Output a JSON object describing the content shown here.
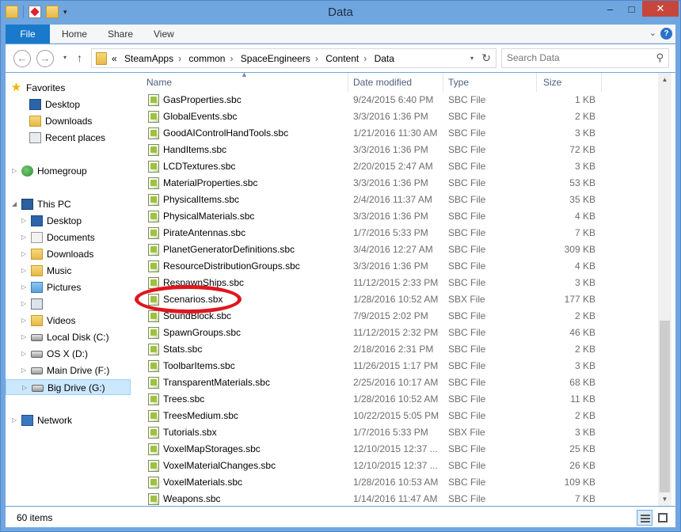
{
  "window": {
    "title": "Data",
    "minimize": "–",
    "maximize": "□",
    "close": "✕"
  },
  "ribbon": {
    "tabs": [
      "File",
      "Home",
      "Share",
      "View"
    ],
    "expand": "⌄",
    "help": "?"
  },
  "nav": {
    "back": "←",
    "forward": "→",
    "up": "↑",
    "history_drop": "▾",
    "breadcrumbs": [
      "«",
      "SteamApps",
      "common",
      "SpaceEngineers",
      "Content",
      "Data"
    ],
    "search_placeholder": "Search Data"
  },
  "navpane": {
    "items": [
      {
        "label": "Favorites",
        "icon": "star-icon"
      },
      {
        "label": "Desktop",
        "icon": "desktop-icon"
      },
      {
        "label": "Downloads",
        "icon": "downloads-icon"
      },
      {
        "label": "Recent places",
        "icon": "recent-places-icon"
      },
      {
        "label": "Homegroup",
        "icon": "homegroup-icon"
      },
      {
        "label": "This PC",
        "icon": "this-pc-icon"
      },
      {
        "label": "Desktop",
        "icon": "desktop-icon"
      },
      {
        "label": "Documents",
        "icon": "documents-icon"
      },
      {
        "label": "Downloads",
        "icon": "downloads-icon"
      },
      {
        "label": "Music",
        "icon": "music-icon"
      },
      {
        "label": "Pictures",
        "icon": "pictures-icon"
      },
      {
        "label": "",
        "icon": "camera-icon"
      },
      {
        "label": "Videos",
        "icon": "videos-icon"
      },
      {
        "label": "Local Disk (C:)",
        "icon": "drive-icon"
      },
      {
        "label": "OS X (D:)",
        "icon": "drive-icon"
      },
      {
        "label": "Main Drive (F:)",
        "icon": "drive-icon"
      },
      {
        "label": "Big Drive (G:)",
        "icon": "drive-icon"
      },
      {
        "label": "Network",
        "icon": "network-icon"
      }
    ]
  },
  "columns": {
    "name": "Name",
    "date": "Date modified",
    "type": "Type",
    "size": "Size",
    "sort_indicator": "▲"
  },
  "files": [
    {
      "name": "GasProperties.sbc",
      "date": "9/24/2015 6:40 PM",
      "type": "SBC File",
      "size": "1 KB"
    },
    {
      "name": "GlobalEvents.sbc",
      "date": "3/3/2016 1:36 PM",
      "type": "SBC File",
      "size": "2 KB"
    },
    {
      "name": "GoodAIControlHandTools.sbc",
      "date": "1/21/2016 11:30 AM",
      "type": "SBC File",
      "size": "3 KB"
    },
    {
      "name": "HandItems.sbc",
      "date": "3/3/2016 1:36 PM",
      "type": "SBC File",
      "size": "72 KB"
    },
    {
      "name": "LCDTextures.sbc",
      "date": "2/20/2015 2:47 AM",
      "type": "SBC File",
      "size": "3 KB"
    },
    {
      "name": "MaterialProperties.sbc",
      "date": "3/3/2016 1:36 PM",
      "type": "SBC File",
      "size": "53 KB"
    },
    {
      "name": "PhysicalItems.sbc",
      "date": "2/4/2016 11:37 AM",
      "type": "SBC File",
      "size": "35 KB"
    },
    {
      "name": "PhysicalMaterials.sbc",
      "date": "3/3/2016 1:36 PM",
      "type": "SBC File",
      "size": "4 KB"
    },
    {
      "name": "PirateAntennas.sbc",
      "date": "1/7/2016 5:33 PM",
      "type": "SBC File",
      "size": "7 KB"
    },
    {
      "name": "PlanetGeneratorDefinitions.sbc",
      "date": "3/4/2016 12:27 AM",
      "type": "SBC File",
      "size": "309 KB"
    },
    {
      "name": "ResourceDistributionGroups.sbc",
      "date": "3/3/2016 1:36 PM",
      "type": "SBC File",
      "size": "4 KB"
    },
    {
      "name": "RespawnShips.sbc",
      "date": "11/12/2015 2:33 PM",
      "type": "SBC File",
      "size": "3 KB"
    },
    {
      "name": "Scenarios.sbx",
      "date": "1/28/2016 10:52 AM",
      "type": "SBX File",
      "size": "177 KB"
    },
    {
      "name": "SoundBlock.sbc",
      "date": "7/9/2015 2:02 PM",
      "type": "SBC File",
      "size": "2 KB"
    },
    {
      "name": "SpawnGroups.sbc",
      "date": "11/12/2015 2:32 PM",
      "type": "SBC File",
      "size": "46 KB"
    },
    {
      "name": "Stats.sbc",
      "date": "2/18/2016 2:31 PM",
      "type": "SBC File",
      "size": "2 KB"
    },
    {
      "name": "ToolbarItems.sbc",
      "date": "11/26/2015 1:17 PM",
      "type": "SBC File",
      "size": "3 KB"
    },
    {
      "name": "TransparentMaterials.sbc",
      "date": "2/25/2016 10:17 AM",
      "type": "SBC File",
      "size": "68 KB"
    },
    {
      "name": "Trees.sbc",
      "date": "1/28/2016 10:52 AM",
      "type": "SBC File",
      "size": "11 KB"
    },
    {
      "name": "TreesMedium.sbc",
      "date": "10/22/2015 5:05 PM",
      "type": "SBC File",
      "size": "2 KB"
    },
    {
      "name": "Tutorials.sbx",
      "date": "1/7/2016 5:33 PM",
      "type": "SBX File",
      "size": "3 KB"
    },
    {
      "name": "VoxelMapStorages.sbc",
      "date": "12/10/2015 12:37 ...",
      "type": "SBC File",
      "size": "25 KB"
    },
    {
      "name": "VoxelMaterialChanges.sbc",
      "date": "12/10/2015 12:37 ...",
      "type": "SBC File",
      "size": "26 KB"
    },
    {
      "name": "VoxelMaterials.sbc",
      "date": "1/28/2016 10:53 AM",
      "type": "SBC File",
      "size": "109 KB"
    },
    {
      "name": "Weapons.sbc",
      "date": "1/14/2016 11:47 AM",
      "type": "SBC File",
      "size": "7 KB"
    }
  ],
  "highlight": {
    "file": "Scenarios.sbx",
    "color": "#e0161e"
  },
  "status": {
    "count": "60 items"
  },
  "colors": {
    "titlebar": "#6fa6e0",
    "file_tab": "#1979ca",
    "close_button": "#c7463c",
    "selected_nav": "#cce8ff"
  }
}
